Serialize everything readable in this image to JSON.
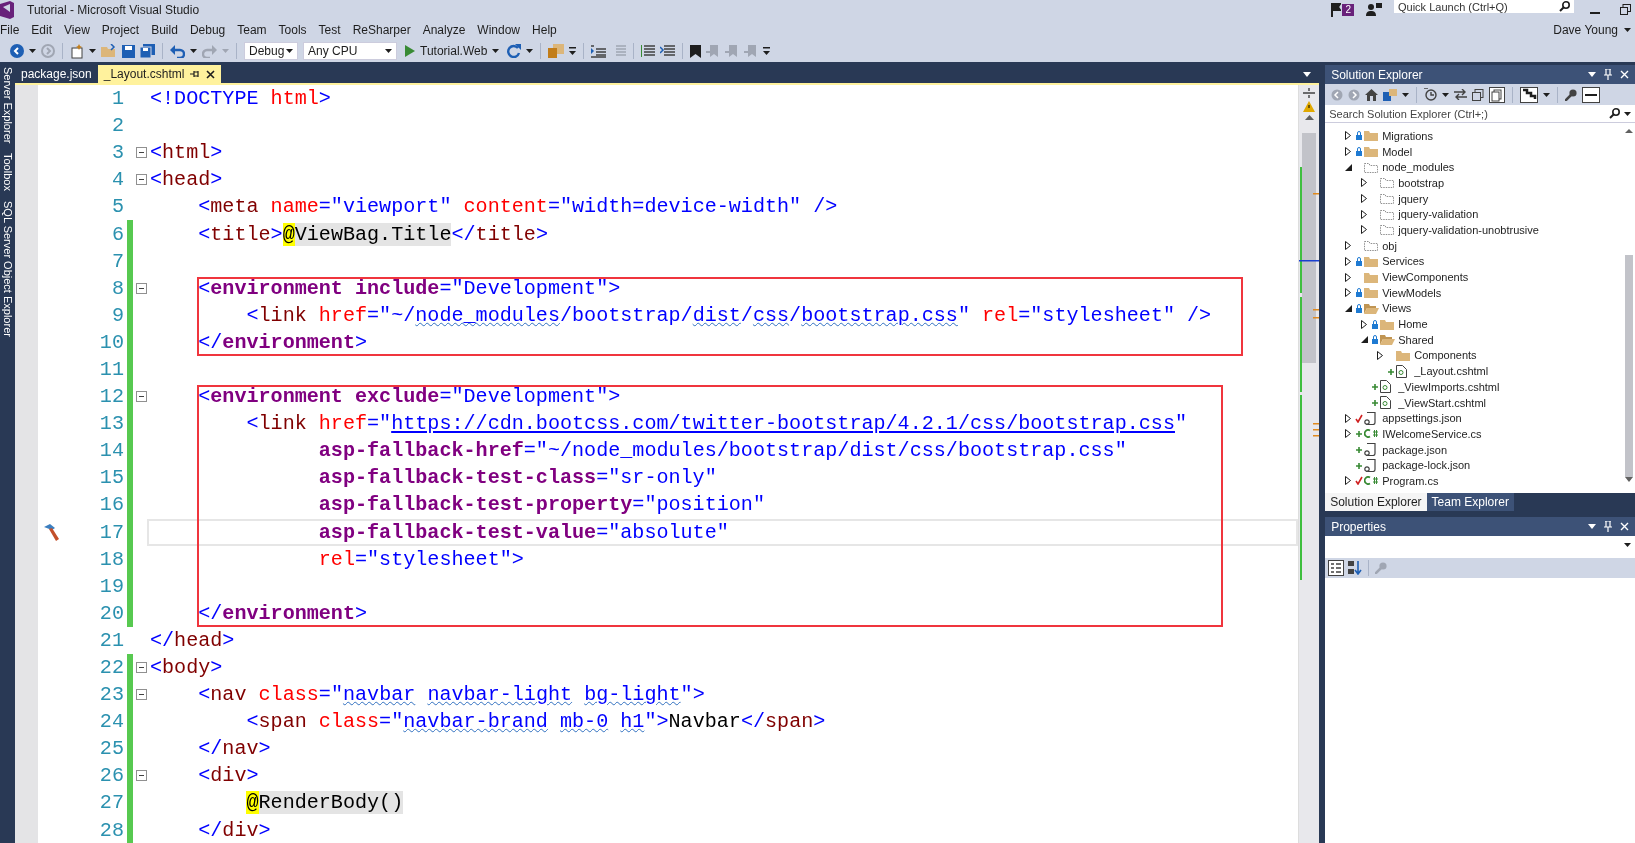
{
  "window": {
    "title": "Tutorial - Microsoft Visual Studio",
    "notification_count": "2",
    "quick_launch": {
      "placeholder": "Quick Launch (Ctrl+Q)"
    },
    "user": "Dave Young"
  },
  "menu": [
    "File",
    "Edit",
    "View",
    "Project",
    "Build",
    "Debug",
    "Team",
    "Tools",
    "Test",
    "ReSharper",
    "Analyze",
    "Window",
    "Help"
  ],
  "toolbar": {
    "configuration": "Debug",
    "platform": "Any CPU",
    "start_target": "Tutorial.Web"
  },
  "side_tabs": [
    "Server Explorer",
    "Toolbox",
    "SQL Server Object Explorer"
  ],
  "doc_tabs": [
    {
      "label": "package.json",
      "selected": false
    },
    {
      "label": "_Layout.cshtml",
      "selected": true
    }
  ],
  "editor": {
    "blocks": [
      {
        "boxed": false,
        "lines": [
          {
            "number": "1",
            "changed": false,
            "fold": false,
            "current": false,
            "quick_action": false,
            "tokens": [
              {
                "kind": "p",
                "text": "<!DOCTYPE"
              },
              {
                "kind": "an",
                "text": " html"
              },
              {
                "kind": "p",
                "text": ">"
              }
            ]
          },
          {
            "number": "2",
            "changed": false,
            "fold": false,
            "current": false,
            "quick_action": false
          },
          {
            "number": "3",
            "changed": false,
            "fold": true,
            "current": false,
            "quick_action": false,
            "tokens": [
              {
                "kind": "p",
                "text": "<"
              },
              {
                "kind": "tn",
                "text": "html"
              },
              {
                "kind": "p",
                "text": ">"
              }
            ]
          },
          {
            "number": "4",
            "changed": false,
            "fold": true,
            "current": false,
            "quick_action": false,
            "tokens": [
              {
                "kind": "p",
                "text": "<"
              },
              {
                "kind": "tn",
                "text": "head"
              },
              {
                "kind": "p",
                "text": ">"
              }
            ]
          },
          {
            "number": "5",
            "changed": false,
            "fold": false,
            "current": false,
            "quick_action": false,
            "tokens": [
              {
                "kind": "p",
                "text": "    <"
              },
              {
                "kind": "tn",
                "text": "meta"
              },
              {
                "kind": "an",
                "text": " name"
              },
              {
                "kind": "p",
                "text": "=\"viewport\""
              },
              {
                "kind": "an",
                "text": " content"
              },
              {
                "kind": "p",
                "text": "=\"width=device-width\" />"
              }
            ]
          },
          {
            "number": "6",
            "changed": true,
            "fold": false,
            "current": false,
            "quick_action": false,
            "tokens": [
              {
                "kind": "p",
                "text": "    <"
              },
              {
                "kind": "tn",
                "text": "title"
              },
              {
                "kind": "p",
                "text": ">"
              },
              {
                "kind": "at",
                "text": "@"
              },
              {
                "kind": "rz",
                "text": "ViewBag.Title"
              },
              {
                "kind": "p",
                "text": "</"
              },
              {
                "kind": "tn",
                "text": "title"
              },
              {
                "kind": "p",
                "text": ">"
              }
            ]
          },
          {
            "number": "7",
            "changed": true,
            "fold": false,
            "current": false,
            "quick_action": false
          }
        ]
      },
      {
        "boxed": true,
        "lines": [
          {
            "number": "8",
            "changed": true,
            "fold": true,
            "current": false,
            "quick_action": false,
            "tokens": [
              {
                "kind": "p",
                "text": "    <"
              },
              {
                "kind": "th",
                "text": "environment"
              },
              {
                "kind": "ah",
                "text": " include"
              },
              {
                "kind": "p",
                "text": "=\"Development\">"
              }
            ]
          },
          {
            "number": "9",
            "changed": true,
            "fold": false,
            "current": false,
            "quick_action": false,
            "tokens": [
              {
                "kind": "p",
                "text": "        <"
              },
              {
                "kind": "tn",
                "text": "link"
              },
              {
                "kind": "an",
                "text": " href"
              },
              {
                "kind": "p",
                "text": "=\"~/"
              },
              {
                "kind": "sq",
                "text": "node_modules"
              },
              {
                "kind": "p",
                "text": "/bootstrap/"
              },
              {
                "kind": "sq",
                "text": "dist"
              },
              {
                "kind": "p",
                "text": "/"
              },
              {
                "kind": "sq",
                "text": "css"
              },
              {
                "kind": "p",
                "text": "/"
              },
              {
                "kind": "sq",
                "text": "bootstrap.css"
              },
              {
                "kind": "p",
                "text": "\""
              },
              {
                "kind": "an",
                "text": " rel"
              },
              {
                "kind": "p",
                "text": "=\"stylesheet\" />"
              }
            ]
          },
          {
            "number": "10",
            "changed": true,
            "fold": false,
            "current": false,
            "quick_action": false,
            "tokens": [
              {
                "kind": "p",
                "text": "    </"
              },
              {
                "kind": "th",
                "text": "environment"
              },
              {
                "kind": "p",
                "text": ">"
              }
            ]
          }
        ]
      },
      {
        "boxed": false,
        "lines": [
          {
            "number": "11",
            "changed": true,
            "fold": false,
            "current": false,
            "quick_action": false
          }
        ]
      },
      {
        "boxed": true,
        "lines": [
          {
            "number": "12",
            "changed": true,
            "fold": true,
            "current": false,
            "quick_action": false,
            "tokens": [
              {
                "kind": "p",
                "text": "    <"
              },
              {
                "kind": "th",
                "text": "environment"
              },
              {
                "kind": "ah",
                "text": " exclude"
              },
              {
                "kind": "p",
                "text": "=\"Development\">"
              }
            ]
          },
          {
            "number": "13",
            "changed": true,
            "fold": false,
            "current": false,
            "quick_action": false,
            "tokens": [
              {
                "kind": "p",
                "text": "        <"
              },
              {
                "kind": "tn",
                "text": "link"
              },
              {
                "kind": "an",
                "text": " href"
              },
              {
                "kind": "p",
                "text": "=\""
              },
              {
                "kind": "url",
                "text": "https://cdn.bootcss.com/twitter-bootstrap/4.2.1/css/bootstrap.css"
              },
              {
                "kind": "p",
                "text": "\""
              }
            ]
          },
          {
            "number": "14",
            "changed": true,
            "fold": false,
            "current": false,
            "quick_action": false,
            "tokens": [
              {
                "kind": "ah",
                "text": "              asp-fallback-href"
              },
              {
                "kind": "p",
                "text": "=\"~/node_modules/bootstrap/dist/css/bootstrap.css\""
              }
            ]
          },
          {
            "number": "15",
            "changed": true,
            "fold": false,
            "current": false,
            "quick_action": false,
            "tokens": [
              {
                "kind": "ah",
                "text": "              asp-fallback-test-class"
              },
              {
                "kind": "p",
                "text": "=\"sr-only\""
              }
            ]
          },
          {
            "number": "16",
            "changed": true,
            "fold": false,
            "current": false,
            "quick_action": false,
            "tokens": [
              {
                "kind": "ah",
                "text": "              asp-fallback-test-property"
              },
              {
                "kind": "p",
                "text": "=\"position\""
              }
            ]
          },
          {
            "number": "17",
            "changed": true,
            "fold": false,
            "current": true,
            "quick_action": true,
            "tokens": [
              {
                "kind": "ah",
                "text": "              asp-fallback-test-value"
              },
              {
                "kind": "p",
                "text": "=\"absolute\""
              }
            ]
          },
          {
            "number": "18",
            "changed": true,
            "fold": false,
            "current": false,
            "quick_action": false,
            "tokens": [
              {
                "kind": "an",
                "text": "              rel"
              },
              {
                "kind": "p",
                "text": "=\"stylesheet\">"
              }
            ]
          },
          {
            "number": "19",
            "changed": true,
            "fold": false,
            "current": false,
            "quick_action": false
          },
          {
            "number": "20",
            "changed": true,
            "fold": false,
            "current": false,
            "quick_action": false,
            "tokens": [
              {
                "kind": "p",
                "text": "    </"
              },
              {
                "kind": "th",
                "text": "environment"
              },
              {
                "kind": "p",
                "text": ">"
              }
            ]
          }
        ]
      },
      {
        "boxed": false,
        "lines": [
          {
            "number": "21",
            "changed": false,
            "fold": false,
            "current": false,
            "quick_action": false,
            "tokens": [
              {
                "kind": "p",
                "text": "</"
              },
              {
                "kind": "tn",
                "text": "head"
              },
              {
                "kind": "p",
                "text": ">"
              }
            ]
          },
          {
            "number": "22",
            "changed": true,
            "fold": true,
            "current": false,
            "quick_action": false,
            "tokens": [
              {
                "kind": "p",
                "text": "<"
              },
              {
                "kind": "tn",
                "text": "body"
              },
              {
                "kind": "p",
                "text": ">"
              }
            ]
          },
          {
            "number": "23",
            "changed": true,
            "fold": true,
            "current": false,
            "quick_action": false,
            "tokens": [
              {
                "kind": "p",
                "text": "    <"
              },
              {
                "kind": "tn",
                "text": "nav"
              },
              {
                "kind": "an",
                "text": " class"
              },
              {
                "kind": "p",
                "text": "=\""
              },
              {
                "kind": "sq",
                "text": "navbar"
              },
              {
                "kind": "sq",
                "text": " navbar-light"
              },
              {
                "kind": "sq",
                "text": " bg-light"
              },
              {
                "kind": "p",
                "text": "\">"
              }
            ]
          },
          {
            "number": "24",
            "changed": true,
            "fold": false,
            "current": false,
            "quick_action": false,
            "tokens": [
              {
                "kind": "p",
                "text": "        <"
              },
              {
                "kind": "tn",
                "text": "span"
              },
              {
                "kind": "an",
                "text": " class"
              },
              {
                "kind": "p",
                "text": "=\""
              },
              {
                "kind": "sq",
                "text": "navbar-brand"
              },
              {
                "kind": "sq",
                "text": " mb-0"
              },
              {
                "kind": "sq",
                "text": " h1"
              },
              {
                "kind": "p",
                "text": "\">"
              },
              {
                "kind": "t",
                "text": "Navbar"
              },
              {
                "kind": "p",
                "text": "</"
              },
              {
                "kind": "tn",
                "text": "span"
              },
              {
                "kind": "p",
                "text": ">"
              }
            ]
          },
          {
            "number": "25",
            "changed": true,
            "fold": false,
            "current": false,
            "quick_action": false,
            "tokens": [
              {
                "kind": "p",
                "text": "    </"
              },
              {
                "kind": "tn",
                "text": "nav"
              },
              {
                "kind": "p",
                "text": ">"
              }
            ]
          },
          {
            "number": "26",
            "changed": true,
            "fold": true,
            "current": false,
            "quick_action": false,
            "tokens": [
              {
                "kind": "p",
                "text": "    <"
              },
              {
                "kind": "tn",
                "text": "div"
              },
              {
                "kind": "p",
                "text": ">"
              }
            ]
          },
          {
            "number": "27",
            "changed": true,
            "fold": false,
            "current": false,
            "quick_action": false,
            "tokens": [
              {
                "kind": "at",
                "text": "        @"
              },
              {
                "kind": "rz",
                "text": "RenderBody()"
              }
            ]
          },
          {
            "number": "28",
            "changed": true,
            "fold": false,
            "current": false,
            "quick_action": false,
            "tokens": [
              {
                "kind": "p",
                "text": "    </"
              },
              {
                "kind": "tn",
                "text": "div"
              },
              {
                "kind": "p",
                "text": ">"
              }
            ]
          }
        ]
      }
    ]
  },
  "solution_explorer": {
    "title": "Solution Explorer",
    "search": {
      "placeholder": "Search Solution Explorer (Ctrl+;)"
    },
    "tree": [
      {
        "label": "Migrations",
        "kind": "folder",
        "locked": true,
        "added": false,
        "edited": false,
        "expanded": false
      },
      {
        "label": "Model",
        "kind": "folder",
        "locked": true,
        "added": false,
        "edited": false,
        "expanded": false
      },
      {
        "label": "node_modules",
        "kind": "dashed",
        "locked": false,
        "added": false,
        "edited": false,
        "expanded": true,
        "children": [
          {
            "label": "bootstrap",
            "kind": "dashed",
            "locked": false,
            "added": false,
            "edited": false,
            "expanded": false
          },
          {
            "label": "jquery",
            "kind": "dashed",
            "locked": false,
            "added": false,
            "edited": false,
            "expanded": false
          },
          {
            "label": "jquery-validation",
            "kind": "dashed",
            "locked": false,
            "added": false,
            "edited": false,
            "expanded": false
          },
          {
            "label": "jquery-validation-unobtrusive",
            "kind": "dashed",
            "locked": false,
            "added": false,
            "edited": false,
            "expanded": false
          }
        ]
      },
      {
        "label": "obj",
        "kind": "dashed",
        "locked": false,
        "added": false,
        "edited": false,
        "expanded": false
      },
      {
        "label": "Services",
        "kind": "folder",
        "locked": true,
        "added": false,
        "edited": false,
        "expanded": false
      },
      {
        "label": "ViewComponents",
        "kind": "folder",
        "locked": false,
        "added": false,
        "edited": false,
        "expanded": false
      },
      {
        "label": "ViewModels",
        "kind": "folder",
        "locked": true,
        "added": false,
        "edited": false,
        "expanded": false
      },
      {
        "label": "Views",
        "kind": "folder",
        "locked": true,
        "added": false,
        "edited": false,
        "expanded": true,
        "children": [
          {
            "label": "Home",
            "kind": "folder",
            "locked": true,
            "added": false,
            "edited": false,
            "expanded": false
          },
          {
            "label": "Shared",
            "kind": "folder",
            "locked": true,
            "added": false,
            "edited": false,
            "expanded": true,
            "children": [
              {
                "label": "Components",
                "kind": "folder",
                "locked": false,
                "added": false,
                "edited": false,
                "expanded": false
              },
              {
                "label": "_Layout.cshtml",
                "kind": "page",
                "locked": false,
                "added": true,
                "edited": false
              }
            ]
          },
          {
            "label": "_ViewImports.cshtml",
            "kind": "page",
            "locked": false,
            "added": true,
            "edited": false
          },
          {
            "label": "_ViewStart.cshtml",
            "kind": "page",
            "locked": false,
            "added": true,
            "edited": false
          }
        ]
      },
      {
        "label": "appsettings.json",
        "kind": "script",
        "locked": false,
        "added": false,
        "edited": true,
        "expanded": false
      },
      {
        "label": "IWelcomeService.cs",
        "kind": "code",
        "locked": false,
        "added": true,
        "edited": false,
        "expanded": false
      },
      {
        "label": "package.json",
        "kind": "script",
        "locked": false,
        "added": true,
        "edited": false
      },
      {
        "label": "package-lock.json",
        "kind": "script",
        "locked": false,
        "added": true,
        "edited": false
      },
      {
        "label": "Program.cs",
        "kind": "code",
        "locked": false,
        "added": false,
        "edited": true,
        "expanded": false
      }
    ],
    "tabs": [
      {
        "label": "Solution Explorer",
        "selected": true
      },
      {
        "label": "Team Explorer",
        "selected": false
      }
    ]
  },
  "properties": {
    "title": "Properties"
  }
}
